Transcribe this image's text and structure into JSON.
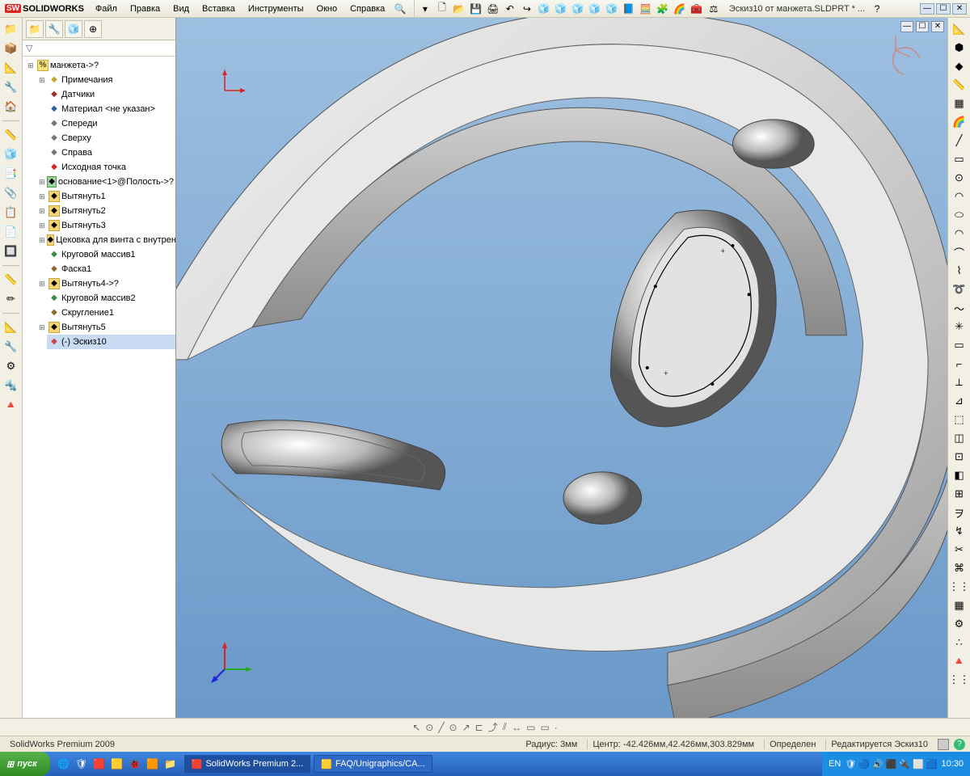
{
  "app": {
    "name": "SolidWorks",
    "logoPrefix": "SW"
  },
  "menus": [
    "Файл",
    "Правка",
    "Вид",
    "Вставка",
    "Инструменты",
    "Окно",
    "Справка"
  ],
  "quickSearch": "🔍",
  "toolbarIcons": [
    "▾",
    "🗋",
    "📂",
    "💾",
    "🖨",
    "↶",
    "↪",
    "🧊",
    "🧊",
    "🧊",
    "🧊",
    "🧊",
    "📘",
    "🧮",
    "🧩",
    "🌈",
    "🧰",
    "⚖"
  ],
  "docTitle": "Эскиз10 от манжета.SLDPRT * ...",
  "winHelp": "?",
  "winCtrls": [
    "—",
    "☐",
    "✕"
  ],
  "leftTools": {
    "group1": [
      "📁",
      "📦",
      "📐",
      "🔧",
      "🏠"
    ],
    "group2": [
      "📏",
      "🧊",
      "📑",
      "📎",
      "📋",
      "📄",
      "🔲"
    ],
    "group3": [
      "📏",
      "✏"
    ],
    "group4": [
      "📐",
      "🔧",
      "⚙",
      "🔩",
      "🔺"
    ]
  },
  "treeTabs": [
    "📁",
    "🔧",
    "🧊",
    "⊕"
  ],
  "filterIcon": "▽",
  "tree": {
    "root": "манжета->?",
    "items": [
      {
        "icon": "ann",
        "label": "Примечания",
        "expandable": true
      },
      {
        "icon": "sensor",
        "label": "Датчики"
      },
      {
        "icon": "mat",
        "label": "Материал <не указан>"
      },
      {
        "icon": "plane",
        "label": "Спереди"
      },
      {
        "icon": "plane",
        "label": "Сверху"
      },
      {
        "icon": "plane",
        "label": "Справа"
      },
      {
        "icon": "origin",
        "label": "Исходная точка"
      },
      {
        "icon": "feat",
        "label": "основание<1>@Полость->?",
        "expandable": true
      },
      {
        "icon": "feat2",
        "label": "Вытянуть1",
        "expandable": true
      },
      {
        "icon": "feat2",
        "label": "Вытянуть2",
        "expandable": true
      },
      {
        "icon": "feat2",
        "label": "Вытянуть3",
        "expandable": true
      },
      {
        "icon": "feat2",
        "label": "Цековка для винта с внутрен",
        "expandable": true
      },
      {
        "icon": "patt",
        "label": "Круговой массив1"
      },
      {
        "icon": "fillet",
        "label": "Фаска1"
      },
      {
        "icon": "feat2",
        "label": "Вытянуть4->?",
        "expandable": true
      },
      {
        "icon": "patt",
        "label": "Круговой массив2"
      },
      {
        "icon": "fillet",
        "label": "Скругление1"
      },
      {
        "icon": "feat2",
        "label": "Вытянуть5",
        "expandable": true
      },
      {
        "icon": "sketch",
        "label": "(-) Эскиз10",
        "selected": true
      }
    ]
  },
  "miniWin": [
    "—",
    "☐",
    "✕"
  ],
  "rightTools": [
    "📐",
    "⬢",
    "◆",
    "📏",
    "▦",
    "🌈",
    "╱",
    "▭",
    "⊙",
    "◠",
    "⬭",
    "◠",
    "⌒",
    "⌇",
    "➰",
    "～",
    "✳",
    "▭",
    "⌐",
    "⟂",
    "⊿",
    "⬚",
    "◫",
    "⊡",
    "◧",
    "⊞",
    "ヲ",
    "↯",
    "✂",
    "⌘",
    "⋮⋮",
    "▦",
    "⚙",
    "∴",
    "🔺",
    "⋮⋮"
  ],
  "sketchTools": [
    "↖",
    "⊙",
    "╱",
    "⊙",
    "↗",
    "⊏",
    "⤴",
    "⫽",
    "↔",
    "▭",
    "▭",
    "·"
  ],
  "status": {
    "product": "SolidWorks Premium 2009",
    "radius": "Радиус: 3мм",
    "center": "Центр: -42.426мм,42.426мм,303.829мм",
    "state": "Определен",
    "editing": "Редактируется Эскиз10",
    "lang": "EN"
  },
  "taskbar": {
    "start": "пуск",
    "quick": [
      "🌐",
      "🛡",
      "🟥",
      "🟨",
      "🐞",
      "🟧",
      "📁"
    ],
    "tasks": [
      {
        "icon": "🟥",
        "label": "SolidWorks Premium 2...",
        "active": true
      },
      {
        "icon": "🟨",
        "label": "FAQ/Unigraphics/CA..."
      }
    ],
    "lang": "EN",
    "tray": [
      "🛡",
      "🔵",
      "🔊",
      "⬛",
      "🔌",
      "⬜",
      "🟦"
    ],
    "time": "10:30"
  }
}
